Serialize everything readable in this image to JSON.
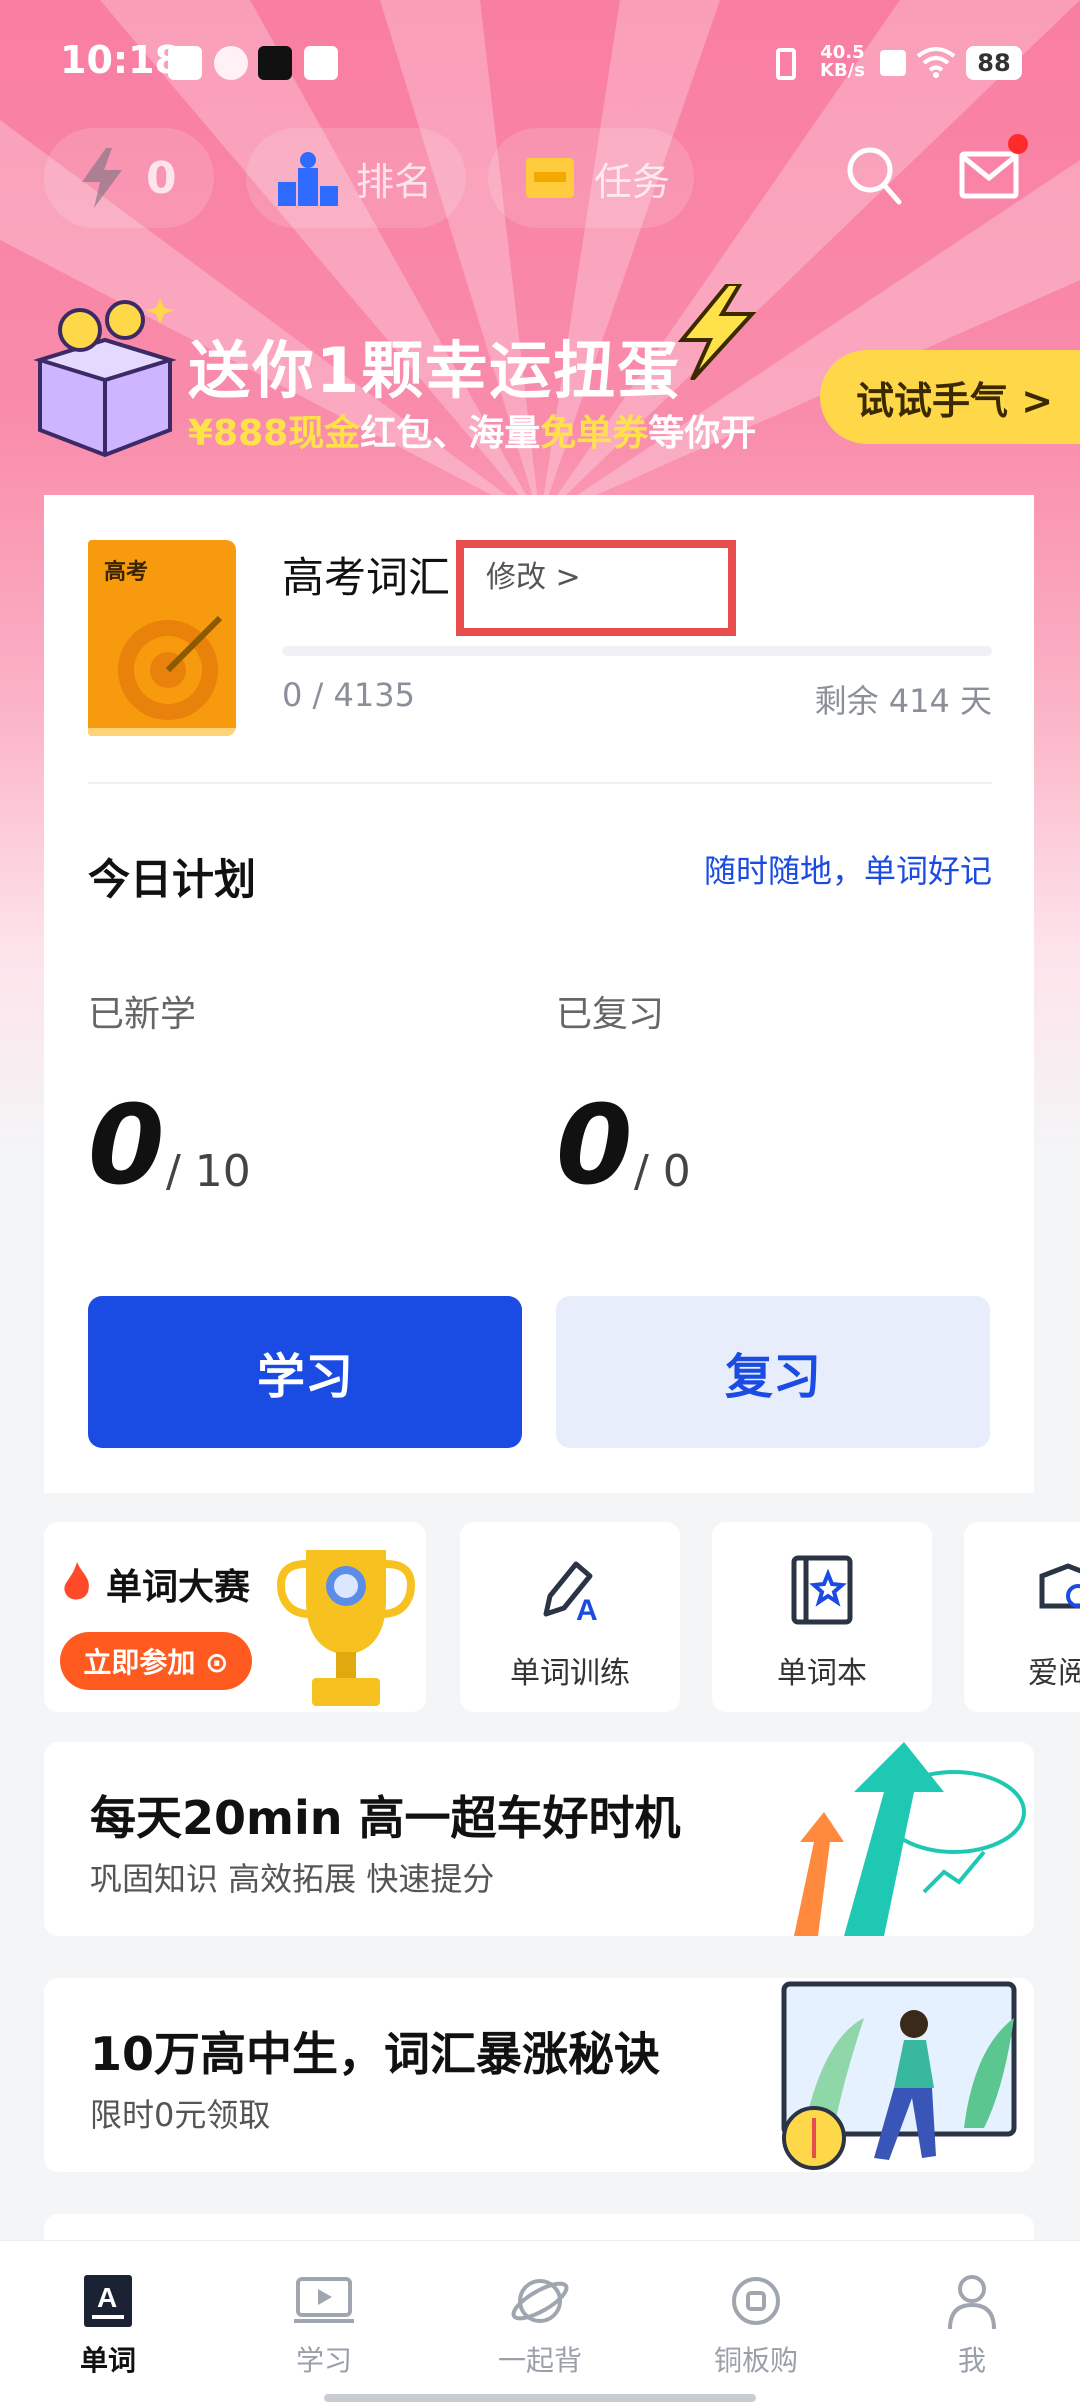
{
  "status_bar": {
    "time": "10:18",
    "net_speed": "40.5",
    "net_unit": "KB/s",
    "battery": "88"
  },
  "top_bar": {
    "energy_count": "0",
    "rank_label": "排名",
    "task_label": "任务"
  },
  "banner": {
    "title": "送你1颗幸运扭蛋",
    "subtitle_parts": [
      "¥888现金",
      "红包、海量",
      "免单券",
      "等你开"
    ],
    "cta": "试试手气 >"
  },
  "book": {
    "cover_text": "高考",
    "title": "高考词汇",
    "edit_label": "修改 >",
    "learned": "0",
    "total": "4135",
    "count_text": "0 / 4135",
    "remaining": "剩余 414 天",
    "progress_fraction": 0.0
  },
  "plan": {
    "title": "今日计划",
    "slogan": "随时随地，单词好记",
    "new_label": "已新学",
    "new_value": "0",
    "new_target": "/ 10",
    "review_label": "已复习",
    "review_value": "0",
    "review_target": "/ 0",
    "learn_button": "学习",
    "review_button": "复习"
  },
  "quick": {
    "contest_title": "单词大赛",
    "contest_cta": "立即参加 ⊙",
    "training": "单词训练",
    "wordbook": "单词本",
    "reading": "爱阅"
  },
  "promos": [
    {
      "headline": "每天20min 高一超车好时机",
      "sub": "巩固知识 高效拓展 快速提分"
    },
    {
      "headline": "10万高中生，词汇暴涨秘诀",
      "sub": "限时0元领取"
    }
  ],
  "nav": {
    "items": [
      "单词",
      "学习",
      "一起背",
      "铜板购",
      "我"
    ],
    "active_index": 0
  },
  "colors": {
    "primary": "#1a4be2",
    "accent_pink": "#f97ea1",
    "yellow": "#ffd84a",
    "orange": "#ff5a1f"
  },
  "icons": [
    "energy-icon",
    "rank-icon",
    "task-icon",
    "search-icon",
    "mail-icon",
    "trophy-icon",
    "pencil-icon",
    "wordbook-icon",
    "reading-icon"
  ]
}
